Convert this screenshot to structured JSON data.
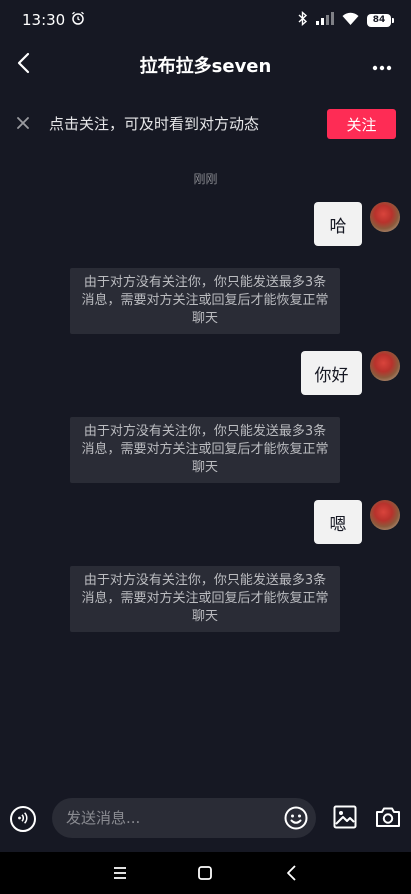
{
  "status_bar": {
    "time": "13:30",
    "battery": "84"
  },
  "nav": {
    "title": "拉布拉多seven"
  },
  "banner": {
    "text": "点击关注，可及时看到对方动态",
    "follow_label": "关注"
  },
  "timestamp": "刚刚",
  "messages": [
    {
      "text": "哈"
    },
    {
      "text": "你好"
    },
    {
      "text": "嗯"
    }
  ],
  "notice_text": "由于对方没有关注你，你只能发送最多3条消息，需要对方关注或回复后才能恢复正常聊天",
  "input": {
    "placeholder": "发送消息..."
  },
  "colors": {
    "background": "#161823",
    "accent": "#fe2c55",
    "bubble": "#f2f2f2",
    "notice_bg": "#2a2c36"
  }
}
